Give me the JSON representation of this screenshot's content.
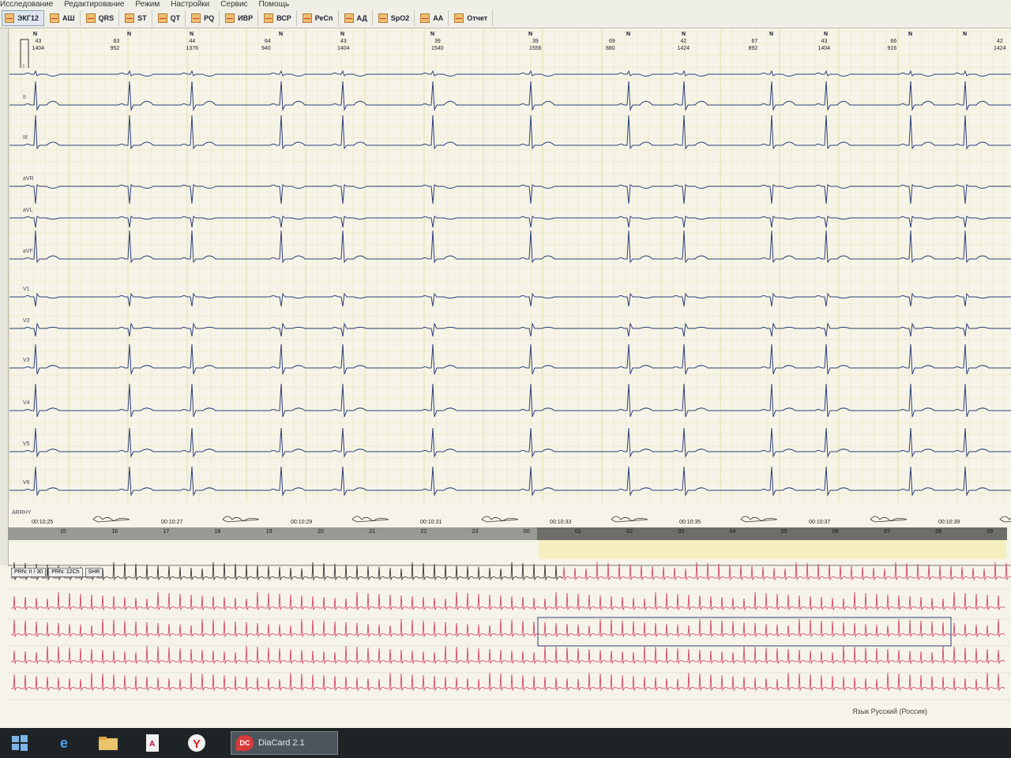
{
  "menu": [
    "Исследование",
    "Редактирование",
    "Режим",
    "Настройки",
    "Сервис",
    "Помощь"
  ],
  "toolbar": [
    {
      "id": "ekg12",
      "label": "ЭКГ12",
      "icon": "ecg-icon",
      "active": true
    },
    {
      "id": "ash",
      "label": "АШ",
      "icon": "ecg-icon"
    },
    {
      "id": "qrs",
      "label": "QRS",
      "icon": "ecg-icon"
    },
    {
      "id": "st",
      "label": "ST",
      "icon": "ecg-icon"
    },
    {
      "id": "qt",
      "label": "QT",
      "icon": "ecg-icon"
    },
    {
      "id": "pq",
      "label": "PQ",
      "icon": "ecg-icon"
    },
    {
      "id": "ivr",
      "label": "ИВР",
      "icon": "heart-icon"
    },
    {
      "id": "vsr",
      "label": "ВСР",
      "icon": "ecg-icon"
    },
    {
      "id": "resp",
      "label": "РеСп",
      "icon": "ecg-icon"
    },
    {
      "id": "ad",
      "label": "АД",
      "icon": "pressure-icon"
    },
    {
      "id": "spo2",
      "label": "SpO2",
      "icon": "oximeter-icon"
    },
    {
      "id": "aa",
      "label": "АА",
      "icon": "person-icon"
    },
    {
      "id": "report",
      "label": "Отчет",
      "icon": "report-icon"
    }
  ],
  "beats": [
    {
      "rate": "43",
      "rr": "1404"
    },
    {
      "rate": "63",
      "rr": "952"
    },
    {
      "rate": "44",
      "rr": "1376"
    },
    {
      "rate": "64",
      "rr": "940"
    },
    {
      "rate": "43",
      "rr": "1404"
    },
    {
      "rate": "39",
      "rr": "1540"
    },
    {
      "rate": "39",
      "rr": "1556"
    },
    {
      "rate": "69",
      "rr": "880"
    },
    {
      "rate": "42",
      "rr": "1424"
    },
    {
      "rate": "67",
      "rr": "892"
    },
    {
      "rate": "43",
      "rr": "1404"
    },
    {
      "rate": "66",
      "rr": "916"
    },
    {
      "rate": "42",
      "rr": "1424"
    }
  ],
  "beat_marker": "N",
  "leads": [
    "I",
    "II",
    "III",
    "aVR",
    "aVL",
    "aVF",
    "V1",
    "V2",
    "V3",
    "V4",
    "V5",
    "V6"
  ],
  "channel_label": "ARRHY",
  "times": [
    "00:10:25",
    "00:10:27",
    "00:10:29",
    "00:10:31",
    "00:10:33",
    "00:10:35",
    "00:10:37",
    "00:10:39"
  ],
  "timeline_ticks": [
    "15",
    "16",
    "17",
    "18",
    "19",
    "20",
    "21",
    "22",
    "23",
    "00",
    "01",
    "02",
    "03",
    "04",
    "05",
    "06",
    "07",
    "08",
    "09"
  ],
  "overview_tags": [
    "PRN: II / 30",
    "PRN: 12Ch",
    "SHR"
  ],
  "status": {
    "language": "Язык Русский (Россия)"
  },
  "taskbar": {
    "app_badge": "DC",
    "app_name": "DiaCard 2.1"
  },
  "colors": {
    "grid": "#e3dfa0",
    "trace": "#2c3e7a",
    "overview_old": "#222222",
    "overview_new": "#d0345e"
  }
}
